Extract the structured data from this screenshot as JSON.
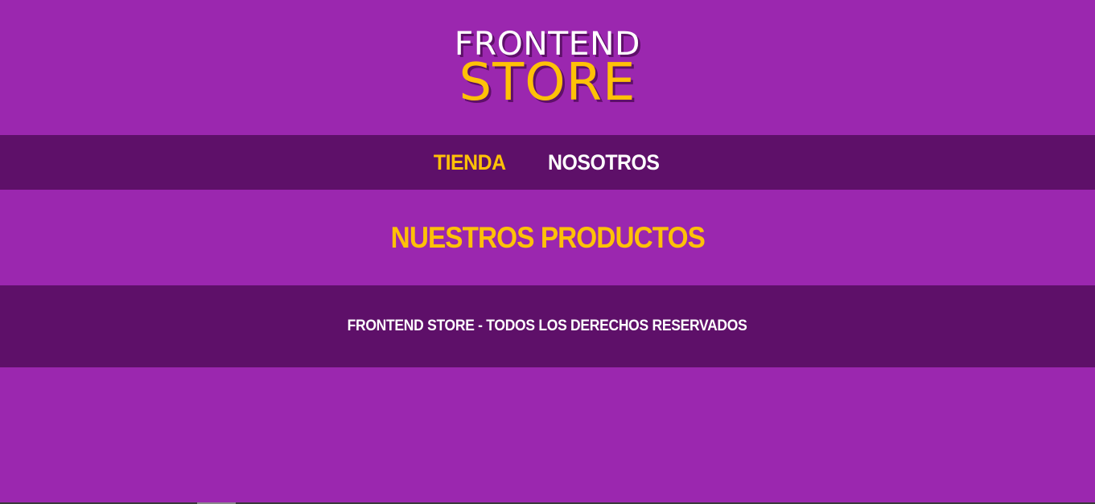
{
  "colors": {
    "background": "#9b27af",
    "bar": "#5e1069",
    "accent": "#ffc107",
    "text_light": "#ffffff"
  },
  "header": {
    "logo_line1": "FRONTEND",
    "logo_line2": "STORE"
  },
  "nav": {
    "items": [
      {
        "label": "TIENDA",
        "active": true
      },
      {
        "label": "NOSOTROS",
        "active": false
      }
    ]
  },
  "main": {
    "title": "NUESTROS PRODUCTOS"
  },
  "footer": {
    "text": "FRONTEND STORE - TODOS LOS DERECHOS RESERVADOS"
  }
}
